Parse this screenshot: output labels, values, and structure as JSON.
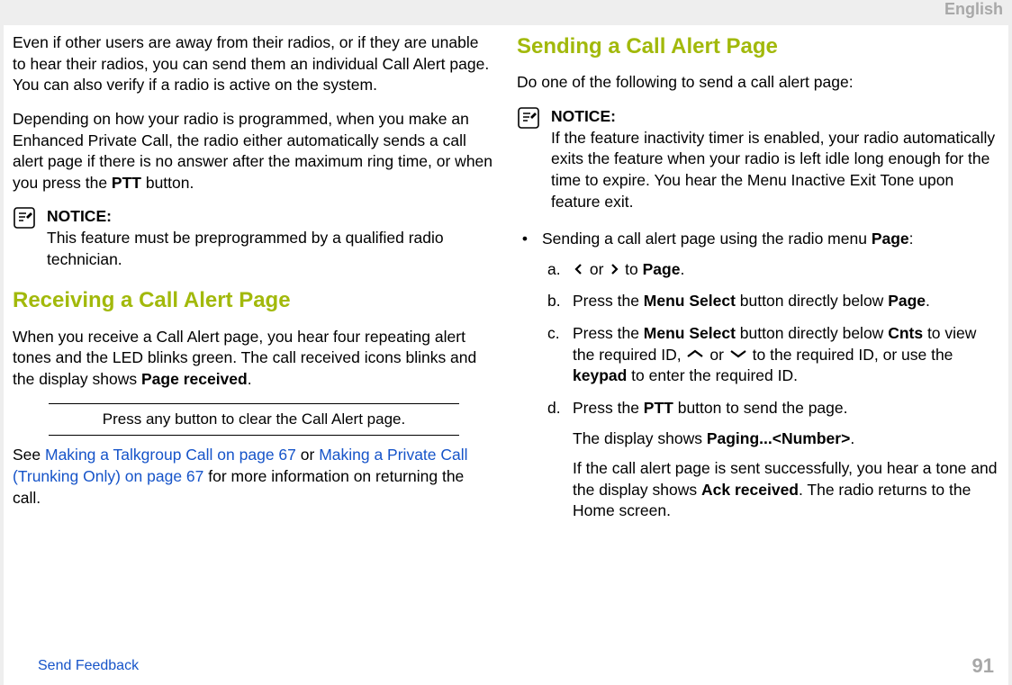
{
  "header": {
    "lang": "English"
  },
  "left": {
    "p1_a": "Even if other users are away from their radios, or if they are unable to hear their radios, you can send them an individual Call Alert page. You can also verify if a radio is active on the system.",
    "p2_pre": "Depending on how your radio is programmed, when you make an Enhanced Private Call, the radio either automatically sends a call alert page if there is no answer after the maximum ring time, or when you press the ",
    "p2_bold": "PTT",
    "p2_post": " button.",
    "notice_label": "NOTICE:",
    "notice_text": "This feature must be preprogrammed by a qualified radio technician.",
    "h_recv": "Receiving a Call Alert Page",
    "recv_p_a": "When you receive a Call Alert page, you hear four repeating alert tones and the LED blinks green. The call received icons blinks and the display shows ",
    "recv_disp": "Page received",
    "recv_p_b": ".",
    "action": "Press any button to clear the Call Alert page.",
    "see_a": "See ",
    "see_link1": "Making a Talkgroup Call on page 67",
    "see_mid": " or ",
    "see_link2": "Making a Private Call (Trunking Only) on page 67",
    "see_tail": " for more information on returning the call."
  },
  "right": {
    "h_send": "Sending a Call Alert Page",
    "intro": "Do one of the following to send a call alert page:",
    "notice_label": "NOTICE:",
    "notice_text": "If the feature inactivity timer is enabled, your radio automatically exits the feature when your radio is left idle long enough for the time to expire. You hear the Menu Inactive Exit Tone upon feature exit.",
    "bullet_a": "Sending a call alert page using the radio menu ",
    "bullet_page": "Page",
    "bullet_b": ":",
    "a_mid": " or ",
    "a_to": " to ",
    "a_page": "Page",
    "a_end": ".",
    "b_pre": "Press the ",
    "b_ms": "Menu Select",
    "b_mid": " button directly below ",
    "b_page": "Page",
    "b_end": ".",
    "c_pre": "Press the ",
    "c_ms": "Menu Select",
    "c_mid": " button directly below ",
    "c_cnts": "Cnts",
    "c_mid2": " to view the required ID, ",
    "c_or": " or ",
    "c_mid3": " to the required ID, or use the ",
    "c_kp": "keypad",
    "c_tail": " to enter the required ID.",
    "d_pre": "Press the ",
    "d_ptt": "PTT",
    "d_post": " button to send the page.",
    "d2_pre": "The display shows ",
    "d2_disp": "Paging...<Number>",
    "d2_post": ".",
    "d3_pre": "If the call alert page is sent successfully, you hear a tone and the display shows ",
    "d3_disp": "Ack received",
    "d3_post": ". The radio returns to the Home screen."
  },
  "footer": {
    "send": "Send Feedback",
    "page": "91"
  }
}
